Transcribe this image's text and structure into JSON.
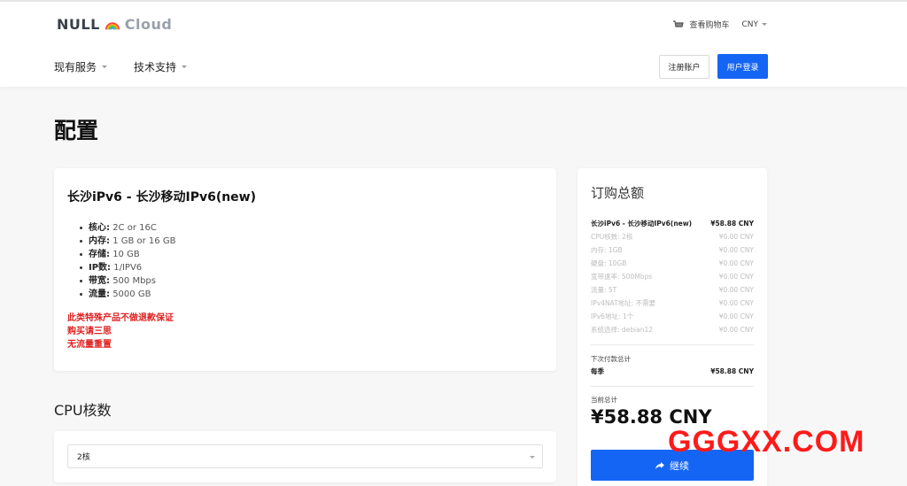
{
  "header": {
    "logo_null": "NULL",
    "logo_cloud": "Cloud",
    "cart_label": "查看购物车",
    "currency": "CNY",
    "nav": [
      {
        "label": "现有服务"
      },
      {
        "label": "技术支持"
      }
    ],
    "register_label": "注册账户",
    "login_label": "用户登录"
  },
  "page": {
    "title": "配置"
  },
  "product": {
    "name": "长沙iPv6 - 长沙移动IPv6(new)",
    "specs": [
      {
        "key": "核心:",
        "value": "2C or 16C"
      },
      {
        "key": "内存:",
        "value": "1 GB or 16 GB"
      },
      {
        "key": "存储:",
        "value": "10 GB"
      },
      {
        "key": "IP数:",
        "value": "1/IPV6"
      },
      {
        "key": "带宽:",
        "value": "500 Mbps"
      },
      {
        "key": "流量:",
        "value": "5000 GB"
      }
    ],
    "warnings": [
      "此类特殊产品不做退款保证",
      "购买请三思",
      "无流量重置"
    ]
  },
  "cpu": {
    "heading": "CPU核数",
    "selected": "2核"
  },
  "summary": {
    "title": "订购总额",
    "main_item": {
      "label": "长沙iPv6 - 长沙移动IPv6(new)",
      "price": "¥58.88 CNY"
    },
    "items": [
      {
        "label": "CPU核数: 2核",
        "price": "¥0.00 CNY"
      },
      {
        "label": "内存: 1GB",
        "price": "¥0.00 CNY"
      },
      {
        "label": "硬盘: 10GB",
        "price": "¥0.00 CNY"
      },
      {
        "label": "宽带速率: 500Mbps",
        "price": "¥0.00 CNY"
      },
      {
        "label": "流量: 5T",
        "price": "¥0.00 CNY"
      },
      {
        "label": "IPv4NAT地址: 不需要",
        "price": "¥0.00 CNY"
      },
      {
        "label": "IPv6地址: 1个",
        "price": "¥0.00 CNY"
      },
      {
        "label": "系统选择: debian12",
        "price": "¥0.00 CNY"
      }
    ],
    "next_label": "下次付款总计",
    "cycle_label": "每季",
    "cycle_price": "¥58.88 CNY",
    "current_label": "当前总计",
    "total": "¥58.88 CNY",
    "continue_label": "继续"
  },
  "watermark": "GGGXX.COM",
  "colors": {
    "accent": "#1565f5",
    "warning": "#e02020",
    "watermark": "#ff1a1a"
  }
}
